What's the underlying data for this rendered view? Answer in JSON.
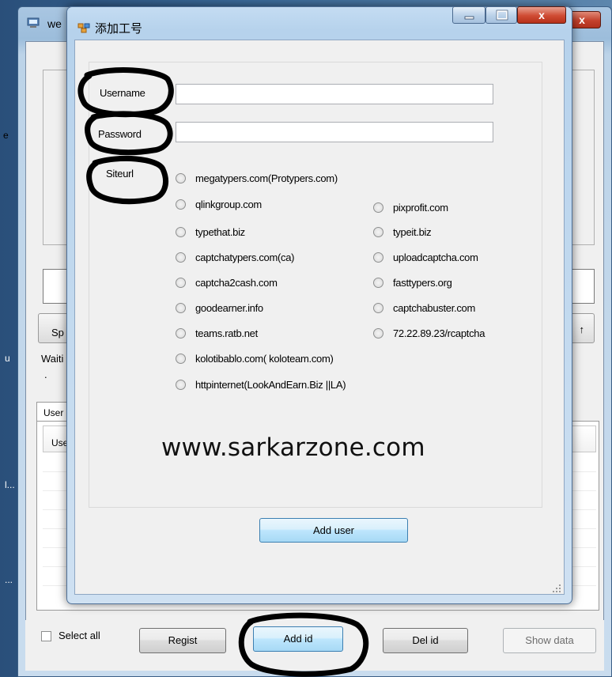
{
  "main_window": {
    "title": "we",
    "close_glyph": "x",
    "left_labels": [
      "e",
      "u",
      "l...",
      "...",
      "..."
    ],
    "speed_button_label": "Sp",
    "up_button_label": "↑",
    "status_label": "Waiti",
    "dot_label": ".",
    "tab_label": "User",
    "list_header": "Use",
    "bottom": {
      "select_all_label": "Select all",
      "buttons": {
        "regist": "Regist",
        "add_id": "Add id",
        "del_id": "Del id",
        "show_data": "Show data"
      }
    }
  },
  "dialog": {
    "title": "添加工号",
    "caption_buttons": [
      "minimize",
      "maximize",
      "close"
    ],
    "close_glyph": "x",
    "username_label": "Username",
    "password_label": "Password",
    "siteurl_label": "Siteurl",
    "username_value": "",
    "password_value": "",
    "sites_left": [
      "megatypers.com(Protypers.com)",
      "qlinkgroup.com",
      "typethat.biz",
      "captchatypers.com(ca)",
      "captcha2cash.com",
      "goodearner.info",
      "teams.ratb.net",
      "kolotibablo.com( koloteam.com)",
      "httpinternet(LookAndEarn.Biz ||LA)"
    ],
    "sites_right": [
      "pixprofit.com",
      "typeit.biz",
      "uploadcaptcha.com",
      "fasttypers.org",
      "captchabuster.com",
      "72.22.89.23/rcaptcha"
    ],
    "watermark": "www.sarkarzone.com",
    "add_user_button": "Add user"
  },
  "colors": {
    "title_bar": "#b6d2ec",
    "close_button": "#cf4b33",
    "focus_button": "#bee6fd",
    "client_bg": "#f0f0f0",
    "annotation": "#000000"
  },
  "icons": [
    "app-icon",
    "dialog-icon",
    "minimize-icon",
    "maximize-icon",
    "close-icon",
    "resize-grip-icon"
  ]
}
